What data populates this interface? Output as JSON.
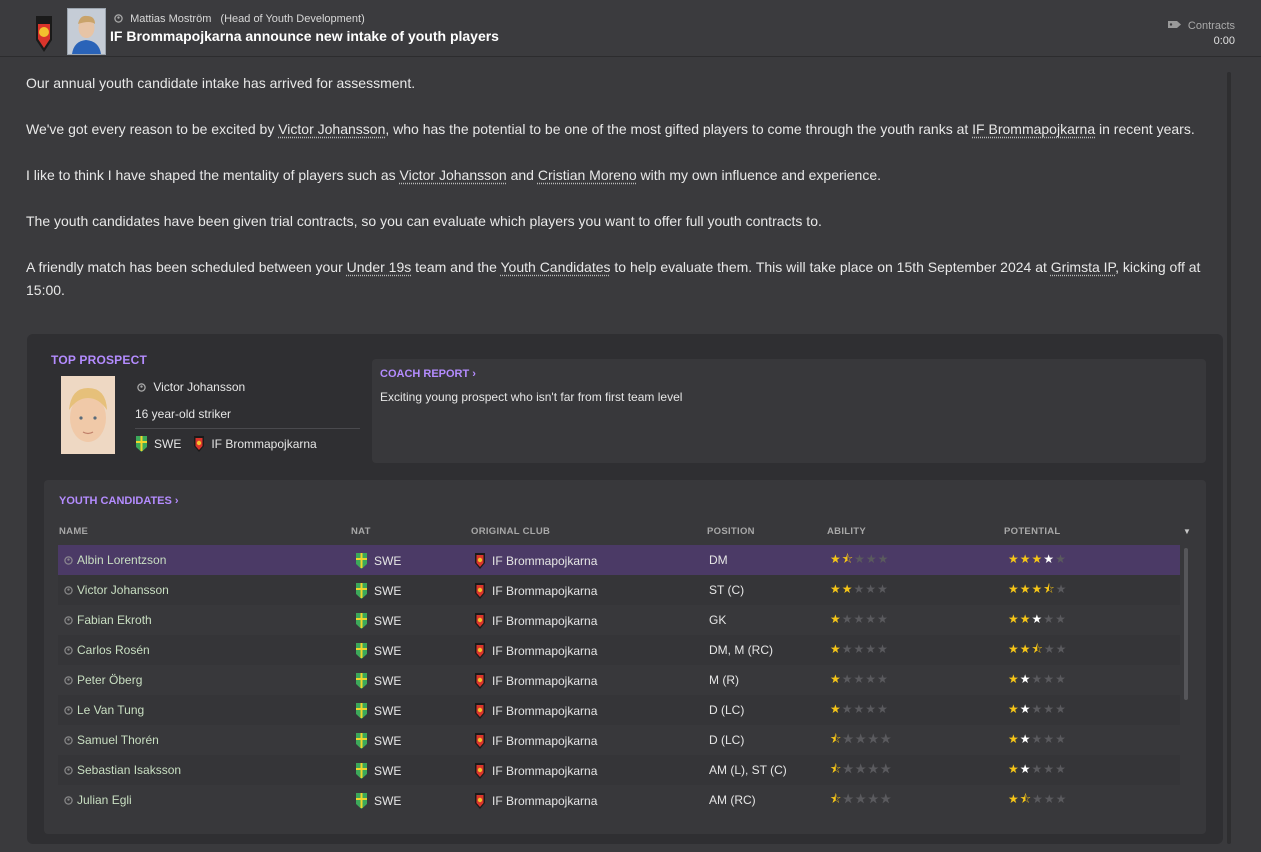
{
  "header": {
    "sender_name": "Mattias Moström",
    "sender_role": "(Head of Youth Development)",
    "headline": "IF Brommapojkarna announce new intake of youth players",
    "category": "Contracts",
    "time": "0:00"
  },
  "message": {
    "p1": "Our annual youth candidate intake has arrived for assessment.",
    "p2_a": "We've got every reason to be excited by ",
    "p2_link1": "Victor Johansson",
    "p2_b": ", who has the potential to be one of the most gifted players to come through the youth ranks at ",
    "p2_link2": "IF Brommapojkarna",
    "p2_c": " in recent years.",
    "p3_a": "I like to think I have shaped the mentality of players such as ",
    "p3_link1": "Victor Johansson",
    "p3_b": " and ",
    "p3_link2": "Cristian Moreno",
    "p3_c": " with my own influence and experience.",
    "p4": "The youth candidates have been given trial contracts, so you can evaluate which players you want to offer full youth contracts to.",
    "p5_a": "A friendly match has been scheduled between your ",
    "p5_link1": "Under 19s",
    "p5_b": " team and the ",
    "p5_link2": "Youth Candidates",
    "p5_c": " to help evaluate them. This will take place on 15th September 2024 at ",
    "p5_link3": "Grimsta IP",
    "p5_d": ", kicking off at 15:00."
  },
  "top_prospect": {
    "title": "TOP PROSPECT",
    "name": "Victor Johansson",
    "description": "16 year-old striker",
    "nation": "SWE",
    "club": "IF Brommapojkarna"
  },
  "coach_report": {
    "title": "COACH REPORT ›",
    "text": "Exciting young prospect who isn't far from first team level"
  },
  "youth_candidates": {
    "title": "YOUTH CANDIDATES ›",
    "columns": {
      "name": "NAME",
      "nat": "NAT",
      "club": "ORIGINAL CLUB",
      "position": "POSITION",
      "ability": "ABILITY",
      "potential": "POTENTIAL"
    },
    "rows": [
      {
        "name": "Albin Lorentzson",
        "nat": "SWE",
        "club": "IF Brommapojkarna",
        "position": "DM",
        "ability": 1.5,
        "potential": 4.0,
        "potential_top_white": true
      },
      {
        "name": "Victor Johansson",
        "nat": "SWE",
        "club": "IF Brommapojkarna",
        "position": "ST (C)",
        "ability": 2.0,
        "potential": 3.5,
        "potential_top_white": true
      },
      {
        "name": "Fabian Ekroth",
        "nat": "SWE",
        "club": "IF Brommapojkarna",
        "position": "GK",
        "ability": 1.0,
        "potential": 3.0,
        "potential_top_white": true
      },
      {
        "name": "Carlos Rosén",
        "nat": "SWE",
        "club": "IF Brommapojkarna",
        "position": "DM, M (RC)",
        "ability": 1.0,
        "potential": 2.5,
        "potential_top_white": true
      },
      {
        "name": "Peter Öberg",
        "nat": "SWE",
        "club": "IF Brommapojkarna",
        "position": "M (R)",
        "ability": 1.0,
        "potential": 2.0,
        "potential_top_white": true
      },
      {
        "name": "Le Van Tung",
        "nat": "SWE",
        "club": "IF Brommapojkarna",
        "position": "D (LC)",
        "ability": 1.0,
        "potential": 2.0,
        "potential_top_white": true
      },
      {
        "name": "Samuel Thorén",
        "nat": "SWE",
        "club": "IF Brommapojkarna",
        "position": "D (LC)",
        "ability": 0.5,
        "potential": 2.0,
        "potential_top_white": true
      },
      {
        "name": "Sebastian Isaksson",
        "nat": "SWE",
        "club": "IF Brommapojkarna",
        "position": "AM (L), ST (C)",
        "ability": 0.5,
        "potential": 2.0,
        "potential_top_white": true
      },
      {
        "name": "Julian Egli",
        "nat": "SWE",
        "club": "IF Brommapojkarna",
        "position": "AM (RC)",
        "ability": 0.5,
        "potential": 1.5,
        "potential_top_white": false
      }
    ]
  },
  "colors": {
    "accent": "#b48cff",
    "selected_row": "#4b3a66",
    "star": "#f5c518"
  }
}
